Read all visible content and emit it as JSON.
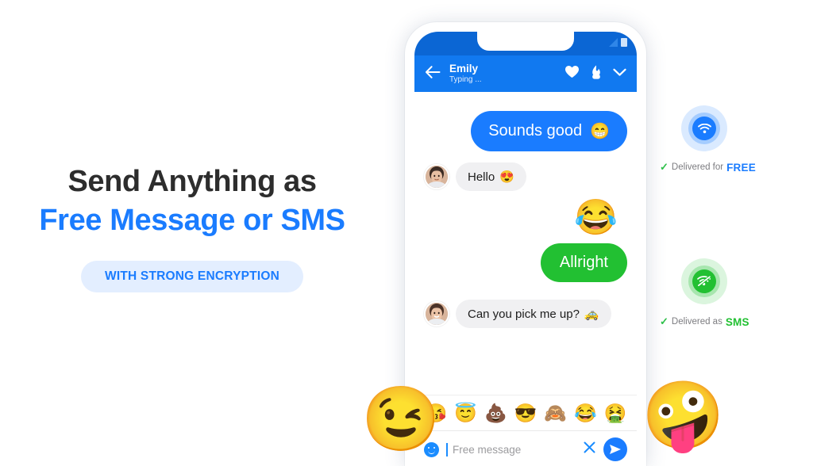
{
  "marketing": {
    "headline_line1": "Send Anything as",
    "headline_line2": "Free Message or SMS",
    "badge": "WITH STRONG ENCRYPTION",
    "accent_color": "#1a7cff",
    "headline_color": "#2d2d2d",
    "badge_bg": "#e3eeff"
  },
  "phone": {
    "status_bar": {
      "signal_icon": "signal-bars-icon",
      "battery_icon": "battery-icon"
    },
    "header": {
      "back_icon": "back-arrow-icon",
      "contact_name": "Emily",
      "contact_status": "Typing ...",
      "actions": [
        {
          "icon": "heart-icon"
        },
        {
          "icon": "flame-icon"
        },
        {
          "icon": "chevron-down-icon"
        }
      ],
      "bg_color": "#1179f0"
    },
    "messages": [
      {
        "id": "msg-sounds-good",
        "direction": "outgoing",
        "kind": "bubble",
        "style": "blue",
        "text": "Sounds good",
        "emoji": "😁"
      },
      {
        "id": "msg-hello",
        "direction": "incoming",
        "kind": "bubble",
        "style": "grey",
        "text": "Hello",
        "emoji": "😍",
        "avatar": "contact-avatar"
      },
      {
        "id": "msg-laugh-emoji",
        "direction": "outgoing",
        "kind": "emoji-only",
        "emoji": "😂"
      },
      {
        "id": "msg-allright",
        "direction": "outgoing",
        "kind": "bubble",
        "style": "green",
        "text": "Allright",
        "emoji": ""
      },
      {
        "id": "msg-pick-me-up",
        "direction": "incoming",
        "kind": "bubble",
        "style": "grey",
        "text": "Can you pick me up?",
        "emoji": "🚕",
        "avatar": "contact-avatar"
      }
    ],
    "emoji_suggestions": [
      {
        "name": "kissing-heart-emoji",
        "glyph": "😘"
      },
      {
        "name": "halo-emoji",
        "glyph": "😇"
      },
      {
        "name": "poop-emoji",
        "glyph": "💩"
      },
      {
        "name": "sunglasses-emoji",
        "glyph": "😎"
      },
      {
        "name": "see-no-evil-monkey-emoji",
        "glyph": "🙈"
      },
      {
        "name": "joy-emoji",
        "glyph": "😂"
      },
      {
        "name": "nauseated-emoji",
        "glyph": "🤮"
      }
    ],
    "input_bar": {
      "emoji_button_icon": "smiley-icon",
      "placeholder": "Free message",
      "value": "",
      "clear_icon": "close-icon",
      "send_icon": "send-icon"
    }
  },
  "badges": [
    {
      "id": "wifi-free",
      "icon": "wifi-icon",
      "color": "#1a7cff",
      "note_prefix": "Delivered for",
      "note_word": "FREE"
    },
    {
      "id": "wifi-off-sms",
      "icon": "wifi-off-icon",
      "color": "#22c032",
      "note_prefix": "Delivered as",
      "note_word": "SMS"
    }
  ],
  "floating_emojis": [
    {
      "name": "winking-face-emoji",
      "glyph": "😉"
    },
    {
      "name": "zany-face-emoji",
      "glyph": "🤪"
    }
  ]
}
